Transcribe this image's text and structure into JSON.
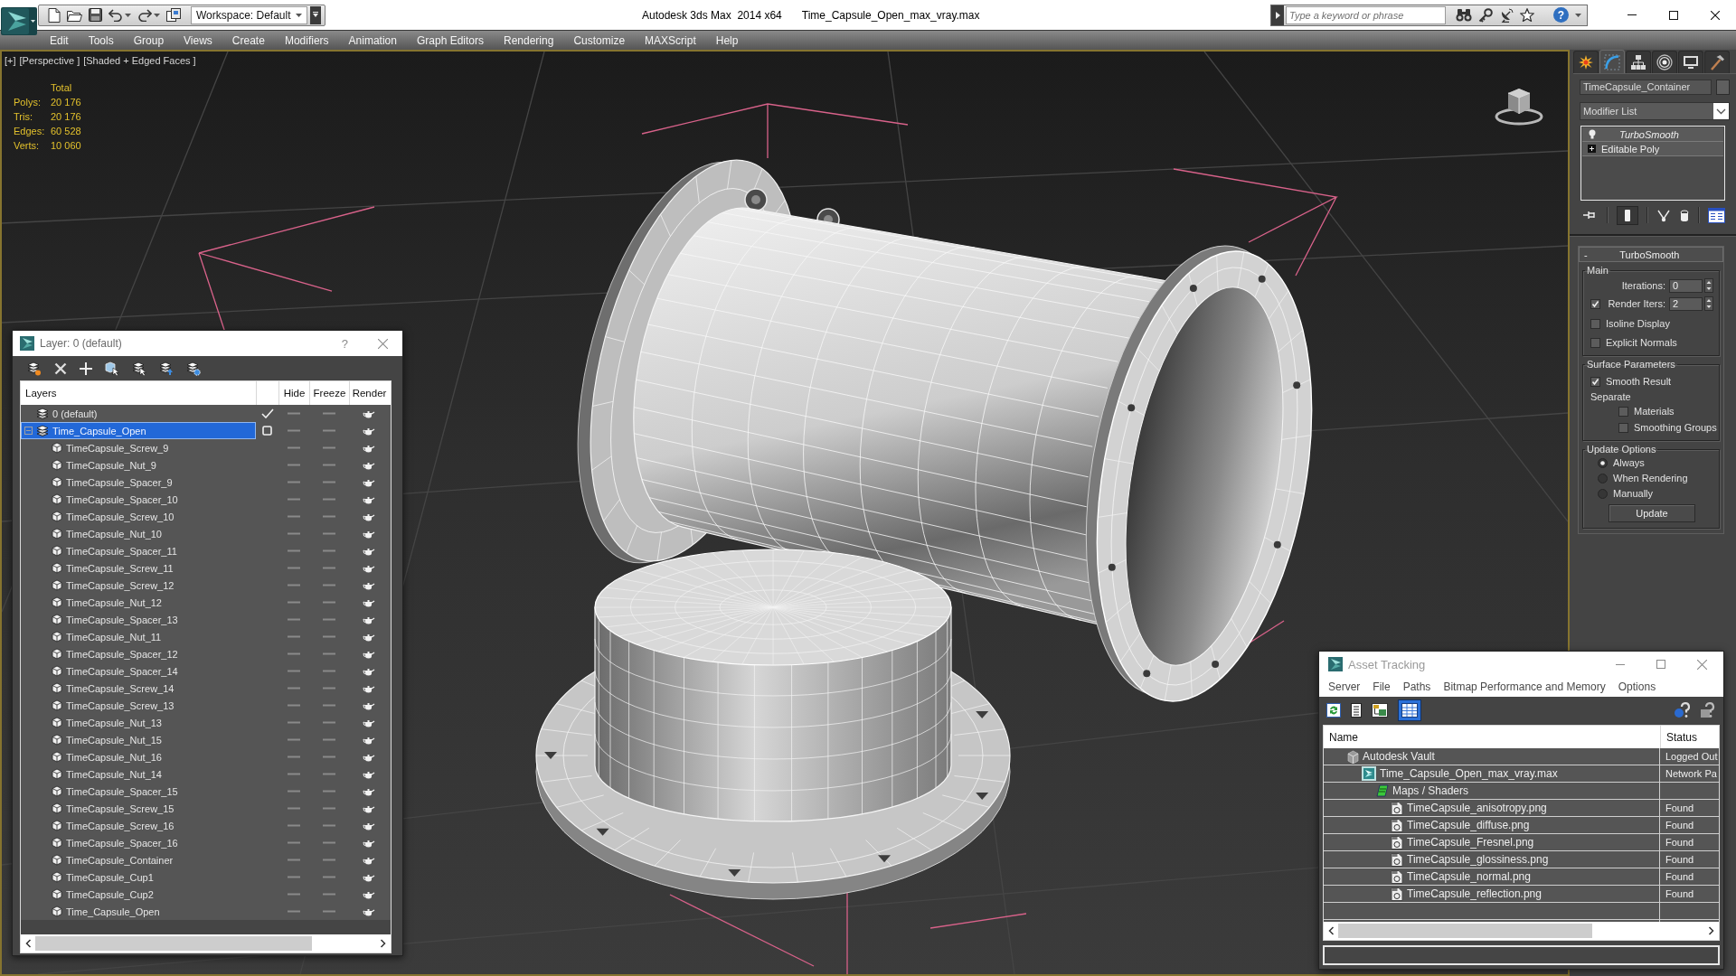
{
  "window": {
    "app": "Autodesk 3ds Max  2014 x64",
    "file": "Time_Capsule_Open_max_vray.max"
  },
  "quick_access": {
    "workspace": "Workspace: Default"
  },
  "infocenter": {
    "placeholder": "Type a keyword or phrase",
    "help": "?"
  },
  "menu": [
    "Edit",
    "Tools",
    "Group",
    "Views",
    "Create",
    "Modifiers",
    "Animation",
    "Graph Editors",
    "Rendering",
    "Customize",
    "MAXScript",
    "Help"
  ],
  "viewport": {
    "labels": [
      "[+]",
      "[Perspective ]",
      "[Shaded + Edged Faces ]"
    ],
    "stats": {
      "header": "Total",
      "rows": [
        {
          "label": "Polys:",
          "value": "20 176"
        },
        {
          "label": "Tris:",
          "value": "20 176"
        },
        {
          "label": "Edges:",
          "value": "60 528"
        },
        {
          "label": "Verts:",
          "value": "10 060"
        }
      ]
    }
  },
  "layer_explorer": {
    "title": "Layer: 0 (default)",
    "help": "?",
    "columns": [
      "Layers",
      "Hide",
      "Freeze",
      "Render"
    ],
    "layers": [
      {
        "name": "0 (default)",
        "selected": false,
        "current": true,
        "hidden": false,
        "frozen": false,
        "renderable": true
      },
      {
        "name": "Time_Capsule_Open",
        "selected": true,
        "current": false,
        "expanded": true,
        "hidden": false,
        "frozen": false,
        "renderable": true,
        "children": [
          {
            "name": "TimeCapsule_Screw_9",
            "selected": false,
            "hidden": false,
            "frozen": false,
            "renderable": true
          },
          {
            "name": "TimeCapsule_Nut_9",
            "selected": false,
            "hidden": false,
            "frozen": false,
            "renderable": true
          },
          {
            "name": "TimeCapsule_Spacer_9",
            "selected": false,
            "hidden": false,
            "frozen": false,
            "renderable": true
          },
          {
            "name": "TimeCapsule_Spacer_10",
            "selected": false,
            "hidden": false,
            "frozen": false,
            "renderable": true
          },
          {
            "name": "TimeCapsule_Screw_10",
            "selected": false,
            "hidden": false,
            "frozen": false,
            "renderable": true
          },
          {
            "name": "TimeCapsule_Nut_10",
            "selected": false,
            "hidden": false,
            "frozen": false,
            "renderable": true
          },
          {
            "name": "TimeCapsule_Spacer_11",
            "selected": false,
            "hidden": false,
            "frozen": false,
            "renderable": true
          },
          {
            "name": "TimeCapsule_Screw_11",
            "selected": false,
            "hidden": false,
            "frozen": false,
            "renderable": true
          },
          {
            "name": "TimeCapsule_Screw_12",
            "selected": false,
            "hidden": false,
            "frozen": false,
            "renderable": true
          },
          {
            "name": "TimeCapsule_Nut_12",
            "selected": false,
            "hidden": false,
            "frozen": false,
            "renderable": true
          },
          {
            "name": "TimeCapsule_Spacer_13",
            "selected": false,
            "hidden": false,
            "frozen": false,
            "renderable": true
          },
          {
            "name": "TimeCapsule_Nut_11",
            "selected": false,
            "hidden": false,
            "frozen": false,
            "renderable": true
          },
          {
            "name": "TimeCapsule_Spacer_12",
            "selected": false,
            "hidden": false,
            "frozen": false,
            "renderable": true
          },
          {
            "name": "TimeCapsule_Spacer_14",
            "selected": false,
            "hidden": false,
            "frozen": false,
            "renderable": true
          },
          {
            "name": "TimeCapsule_Screw_14",
            "selected": false,
            "hidden": false,
            "frozen": false,
            "renderable": true
          },
          {
            "name": "TimeCapsule_Screw_13",
            "selected": false,
            "hidden": false,
            "frozen": false,
            "renderable": true
          },
          {
            "name": "TimeCapsule_Nut_13",
            "selected": false,
            "hidden": false,
            "frozen": false,
            "renderable": true
          },
          {
            "name": "TimeCapsule_Nut_15",
            "selected": false,
            "hidden": false,
            "frozen": false,
            "renderable": true
          },
          {
            "name": "TimeCapsule_Nut_16",
            "selected": false,
            "hidden": false,
            "frozen": false,
            "renderable": true
          },
          {
            "name": "TimeCapsule_Nut_14",
            "selected": false,
            "hidden": false,
            "frozen": false,
            "renderable": true
          },
          {
            "name": "TimeCapsule_Spacer_15",
            "selected": false,
            "hidden": false,
            "frozen": false,
            "renderable": true
          },
          {
            "name": "TimeCapsule_Screw_15",
            "selected": false,
            "hidden": false,
            "frozen": false,
            "renderable": true
          },
          {
            "name": "TimeCapsule_Screw_16",
            "selected": false,
            "hidden": false,
            "frozen": false,
            "renderable": true
          },
          {
            "name": "TimeCapsule_Spacer_16",
            "selected": false,
            "hidden": false,
            "frozen": false,
            "renderable": true
          },
          {
            "name": "TimeCapsule_Container",
            "selected": false,
            "hidden": false,
            "frozen": false,
            "renderable": true
          },
          {
            "name": "TimeCapsule_Cup1",
            "selected": false,
            "hidden": false,
            "frozen": false,
            "renderable": true
          },
          {
            "name": "TimeCapsule_Cup2",
            "selected": false,
            "hidden": false,
            "frozen": false,
            "renderable": true
          },
          {
            "name": "Time_Capsule_Open",
            "selected": false,
            "hidden": false,
            "frozen": false,
            "renderable": true
          }
        ]
      }
    ]
  },
  "command_panel": {
    "tabs": [
      {
        "selected": false
      },
      {
        "selected": true
      },
      {
        "selected": false
      },
      {
        "selected": false
      },
      {
        "selected": false
      },
      {
        "selected": false
      }
    ],
    "object_name": "TimeCapsule_Container",
    "modifier_list": "Modifier List",
    "stack": [
      {
        "name": "TurboSmooth",
        "kind": "modifier"
      },
      {
        "name": "Editable Poly",
        "kind": "base_object"
      }
    ],
    "stack_tools": [
      {
        "on": false
      },
      {
        "on": true
      },
      {
        "on": false
      },
      {
        "on": false
      },
      {
        "on": false
      }
    ],
    "rollout": {
      "title": "TurboSmooth",
      "toggle": "-",
      "groups": [
        {
          "title": "Main",
          "items": [
            {
              "kind": "spinner",
              "label": "Iterations:",
              "value": "0"
            },
            {
              "kind": "check_spinner",
              "label": "Render Iters:",
              "checked": true,
              "value": "2"
            },
            {
              "kind": "checkbox",
              "label": "Isoline Display",
              "checked": false
            },
            {
              "kind": "checkbox",
              "label": "Explicit Normals",
              "checked": false
            }
          ]
        },
        {
          "title": "Surface Parameters",
          "items": [
            {
              "kind": "checkbox",
              "label": "Smooth Result",
              "checked": true
            },
            {
              "kind": "subgroup",
              "label": "Separate",
              "children": [
                {
                  "kind": "checkbox",
                  "label": "Materials",
                  "checked": false
                },
                {
                  "kind": "checkbox",
                  "label": "Smoothing Groups",
                  "checked": false
                }
              ]
            }
          ]
        },
        {
          "title": "Update Options",
          "items": [
            {
              "kind": "radio",
              "label": "Always",
              "selected": true
            },
            {
              "kind": "radio",
              "label": "When Rendering",
              "selected": false
            },
            {
              "kind": "radio",
              "label": "Manually",
              "selected": false
            },
            {
              "kind": "button",
              "label": "Update"
            }
          ]
        }
      ]
    }
  },
  "asset_tracking": {
    "title": "Asset Tracking",
    "menu": [
      "Server",
      "File",
      "Paths",
      "Bitmap Performance and Memory",
      "Options"
    ],
    "views": [
      {
        "selected": false
      },
      {
        "selected": false
      },
      {
        "selected": false
      },
      {
        "selected": true
      }
    ],
    "columns": [
      "Name",
      "Status"
    ],
    "rows": [
      {
        "name": "Autodesk Vault",
        "status": "Logged Out",
        "kind": "vault",
        "selected": false,
        "children": [
          {
            "name": "Time_Capsule_Open_max_vray.max",
            "status": "Network Pa",
            "kind": "scene",
            "selected": false,
            "children": [
              {
                "name": "Maps / Shaders",
                "kind": "maps",
                "selected": false,
                "children": [
                  {
                    "name": "TimeCapsule_anisotropy.png",
                    "status": "Found",
                    "kind": "bitmap",
                    "selected": false
                  },
                  {
                    "name": "TimeCapsule_diffuse.png",
                    "status": "Found",
                    "kind": "bitmap",
                    "selected": false
                  },
                  {
                    "name": "TimeCapsule_Fresnel.png",
                    "status": "Found",
                    "kind": "bitmap",
                    "selected": false
                  },
                  {
                    "name": "TimeCapsule_glossiness.png",
                    "status": "Found",
                    "kind": "bitmap",
                    "selected": false
                  },
                  {
                    "name": "TimeCapsule_normal.png",
                    "status": "Found",
                    "kind": "bitmap",
                    "selected": false
                  },
                  {
                    "name": "TimeCapsule_reflection.png",
                    "status": "Found",
                    "kind": "bitmap",
                    "selected": false
                  }
                ]
              }
            ]
          }
        ]
      }
    ]
  }
}
